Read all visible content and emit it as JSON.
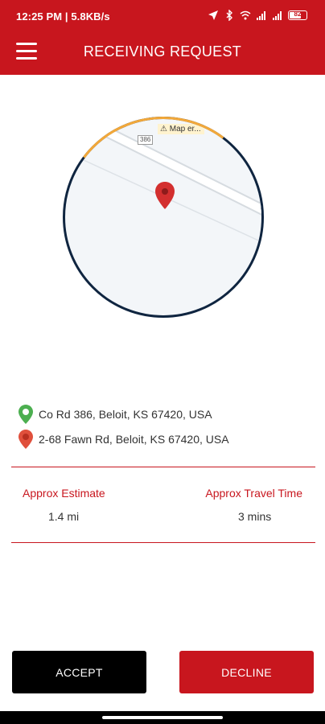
{
  "status_bar": {
    "time": "12:25 PM | 5.8KB/s",
    "battery": "82"
  },
  "header": {
    "title": "RECEIVING REQUEST",
    "background": "#c8161e"
  },
  "map": {
    "road_label": "386",
    "error_text": "Map er..."
  },
  "route": {
    "origin": "Co Rd 386, Beloit, KS 67420, USA",
    "destination": "2-68 Fawn Rd, Beloit, KS 67420, USA"
  },
  "estimates": {
    "distance_label": "Approx Estimate",
    "distance_value": "1.4 mi",
    "time_label": "Approx Travel Time",
    "time_value": "3 mins"
  },
  "actions": {
    "accept_label": "ACCEPT",
    "decline_label": "DECLINE"
  },
  "icons": [
    "menu-icon",
    "navigation-arrow-icon",
    "bluetooth-icon",
    "wifi-icon",
    "signal-icon",
    "battery-icon",
    "alarm-icon",
    "map-pin-icon",
    "origin-pin-icon",
    "destination-pin-icon",
    "warning-icon"
  ]
}
